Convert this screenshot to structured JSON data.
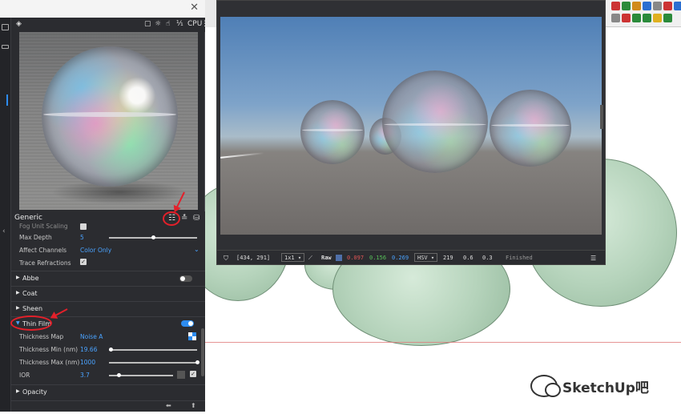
{
  "preview": {
    "toolbar": {
      "engine": "CPU"
    },
    "panel_title": "Generic"
  },
  "params": {
    "cut_label": "Fog Unit Scaling",
    "max_depth": {
      "label": "Max Depth",
      "value": "5",
      "level": 0.5
    },
    "affect_channels": {
      "label": "Affect Channels",
      "value": "Color Only"
    },
    "trace_refractions": {
      "label": "Trace Refractions",
      "checked": true
    },
    "abbe": {
      "label": "Abbe",
      "enabled": false
    },
    "coat": {
      "label": "Coat"
    },
    "sheen": {
      "label": "Sheen"
    },
    "thin_film": {
      "label": "Thin Film",
      "enabled": true,
      "thickness_map": {
        "label": "Thickness Map",
        "value": "Noise A"
      },
      "thickness_min": {
        "label": "Thickness Min (nm)",
        "value": "19.66",
        "level": 0.02
      },
      "thickness_max": {
        "label": "Thickness Max (nm)",
        "value": "1000",
        "level": 1.0
      },
      "ior": {
        "label": "IOR",
        "value": "3.7",
        "level": 0.15
      }
    },
    "opacity": {
      "label": "Opacity"
    }
  },
  "vfb": {
    "coords": "[434, 291]",
    "zoom": "1x1",
    "channel_mode": "Raw",
    "r": "0.097",
    "g": "0.156",
    "b": "0.269",
    "color_mode": "HSV",
    "h": "219",
    "s": "0.6",
    "v": "0.3",
    "status": "Finished",
    "colors": {
      "r": "#e05555",
      "g": "#58c45a",
      "b": "#4aa3ff"
    }
  },
  "watermark": {
    "text": "SketchUp吧"
  },
  "colors": {
    "accent": "#2d8cf0",
    "annotation": "#e3202a"
  }
}
